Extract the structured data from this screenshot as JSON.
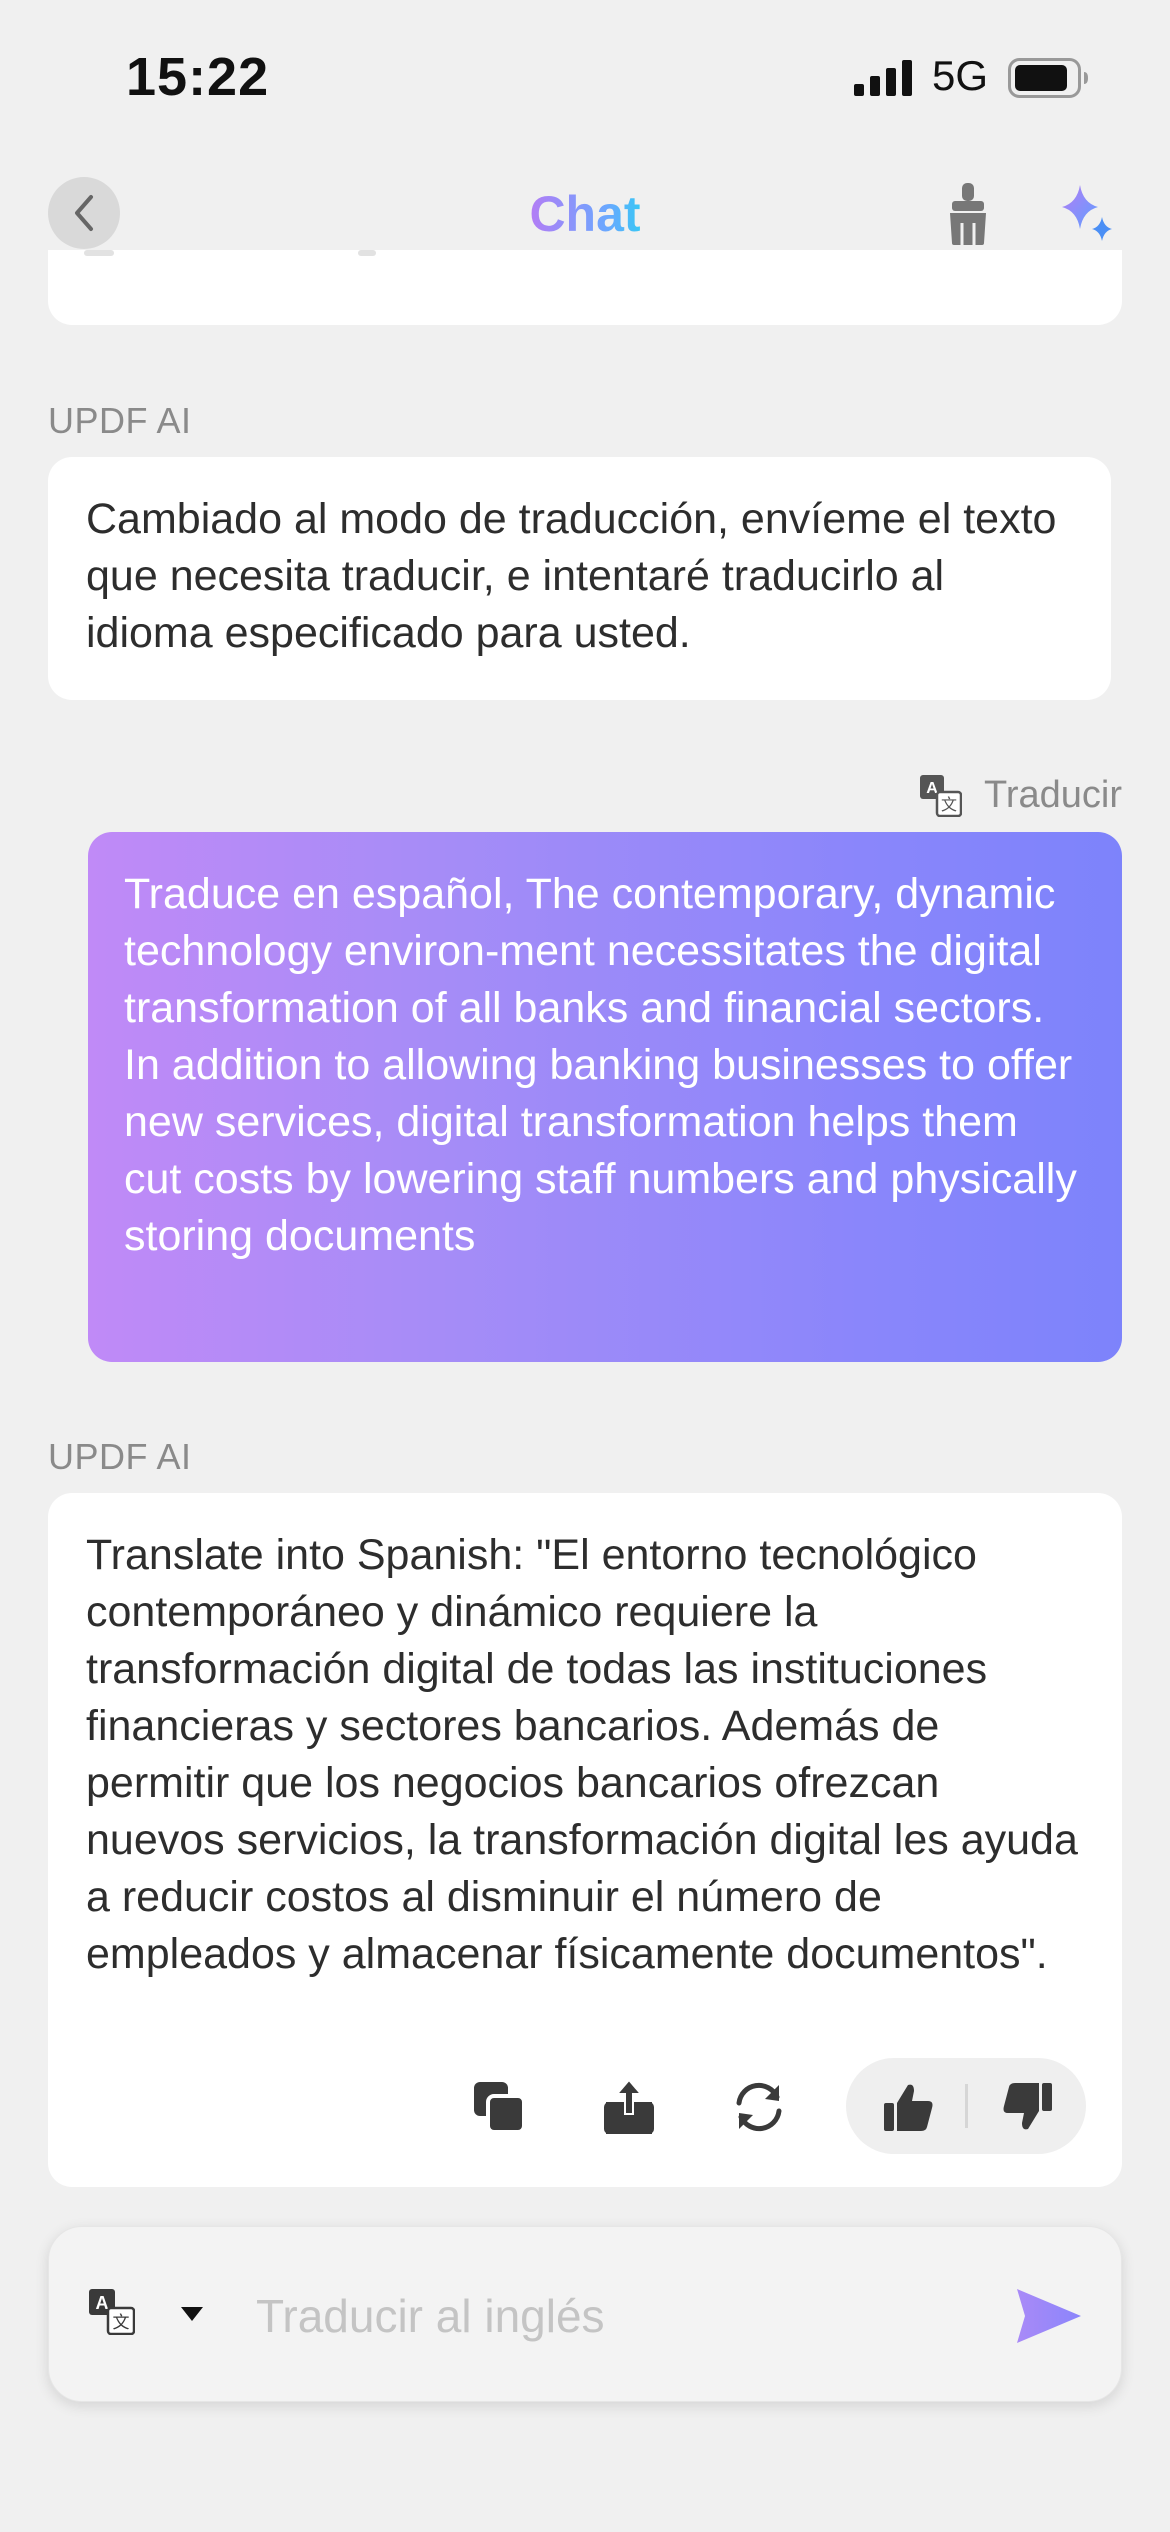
{
  "status_bar": {
    "time": "15:22",
    "network": "5G"
  },
  "nav": {
    "title": "Chat"
  },
  "messages": [
    {
      "sender": "UPDF AI",
      "text": "Cambiado al modo de traducción, envíeme el texto que necesita traducir, e intentaré traducirlo al idioma especificado para usted."
    },
    {
      "tag": "Traducir",
      "text": "Traduce en español, The contemporary, dynamic technology environ-ment necessitates the digital transformation of all banks and financial sectors. In addition to allowing banking businesses to offer new services, digital transformation helps them cut costs by lowering staff numbers and physically storing documents"
    },
    {
      "sender": "UPDF AI",
      "text": "Translate into Spanish: \"El entorno tecnológico contemporáneo y dinámico requiere la transformación digital de todas las instituciones financieras y sectores bancarios. Además de permitir que los negocios bancarios ofrezcan nuevos servicios, la transformación digital les ayuda a reducir costos al disminuir el número de empleados y almacenar físicamente documentos\"."
    }
  ],
  "composer": {
    "placeholder": "Traducir al inglés"
  },
  "colors": {
    "accent": "#8b85fb",
    "bubble_gradient_start": "#c08af7",
    "bubble_gradient_end": "#7d83fb",
    "background": "#f0f0f0"
  }
}
